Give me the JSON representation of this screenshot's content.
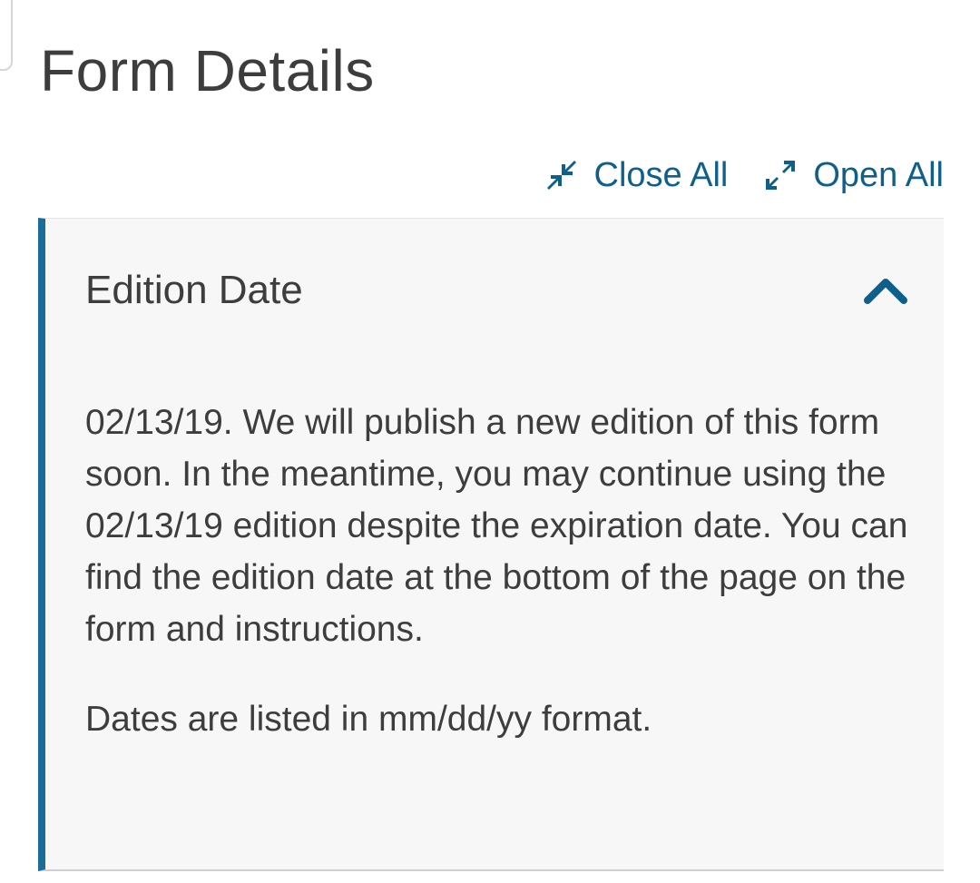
{
  "page": {
    "title": "Form Details"
  },
  "toolbar": {
    "close_all": {
      "label": "Close All",
      "icon": "collapse-arrows-icon"
    },
    "open_all": {
      "label": "Open All",
      "icon": "expand-arrows-icon"
    }
  },
  "accordion": {
    "section_title": "Edition Date",
    "state": "expanded",
    "chevron_icon": "chevron-up-icon",
    "body": {
      "paragraph": "02/13/19. We will publish a new edition of this form soon. In the meantime, you may continue using the 02/13/19 edition despite the expiration date. You can find the edition date at the bottom of the page on the form and instructions.",
      "note": "Dates are listed in mm/dd/yy format."
    }
  },
  "colors": {
    "link": "#0f5f8c",
    "accent_border": "#1a6c99",
    "panel_background": "#f7f7f7",
    "text": "#3d3d3d"
  }
}
